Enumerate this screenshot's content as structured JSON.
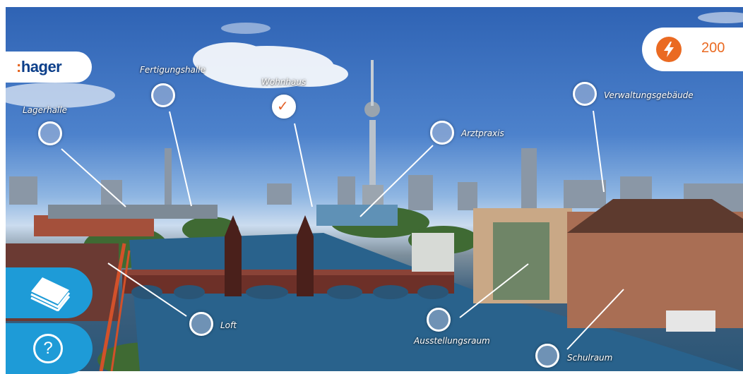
{
  "brand": {
    "logo_prefix": ":",
    "logo_name": "hager"
  },
  "score": {
    "value": "200",
    "icon": "lightning-bolt-icon"
  },
  "locations": [
    {
      "id": "lagerhalle",
      "label": "Lagerhalle",
      "completed": false
    },
    {
      "id": "fertigungshalle",
      "label": "Fertigungshalle",
      "completed": false
    },
    {
      "id": "wohnhaus",
      "label": "Wohnhaus",
      "completed": true
    },
    {
      "id": "arztpraxis",
      "label": "Arztpraxis",
      "completed": false
    },
    {
      "id": "verwaltungsgebaeude",
      "label": "Verwaltungsgebäude",
      "completed": false
    },
    {
      "id": "loft",
      "label": "Loft",
      "completed": false
    },
    {
      "id": "ausstellungsraum",
      "label": "Ausstellungsraum",
      "completed": false
    },
    {
      "id": "schulraum",
      "label": "Schulraum",
      "completed": false
    }
  ],
  "sidebar": {
    "catalog_icon": "book-icon",
    "help_icon": "question-mark-icon",
    "help_glyph": "?"
  },
  "colors": {
    "accent_orange": "#ea6a22",
    "button_blue": "#1e9bd7",
    "brand_blue": "#0c3f8a"
  }
}
